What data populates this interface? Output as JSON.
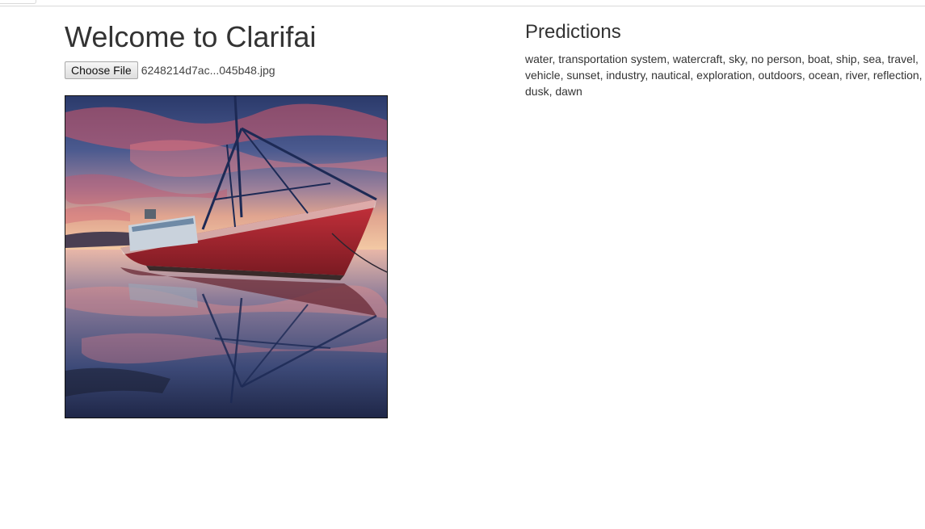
{
  "page": {
    "title": "Welcome to Clarifai"
  },
  "upload": {
    "button_label": "Choose File",
    "file_name": "6248214d7ac...045b48.jpg"
  },
  "image": {
    "description_icon": "uploaded-photo"
  },
  "predictions": {
    "heading": "Predictions",
    "text": "water, transportation system, watercraft, sky, no person, boat, ship, sea, travel, vehicle, sunset, industry, nautical, exploration, outdoors, ocean, river, reflection, dusk, dawn"
  }
}
